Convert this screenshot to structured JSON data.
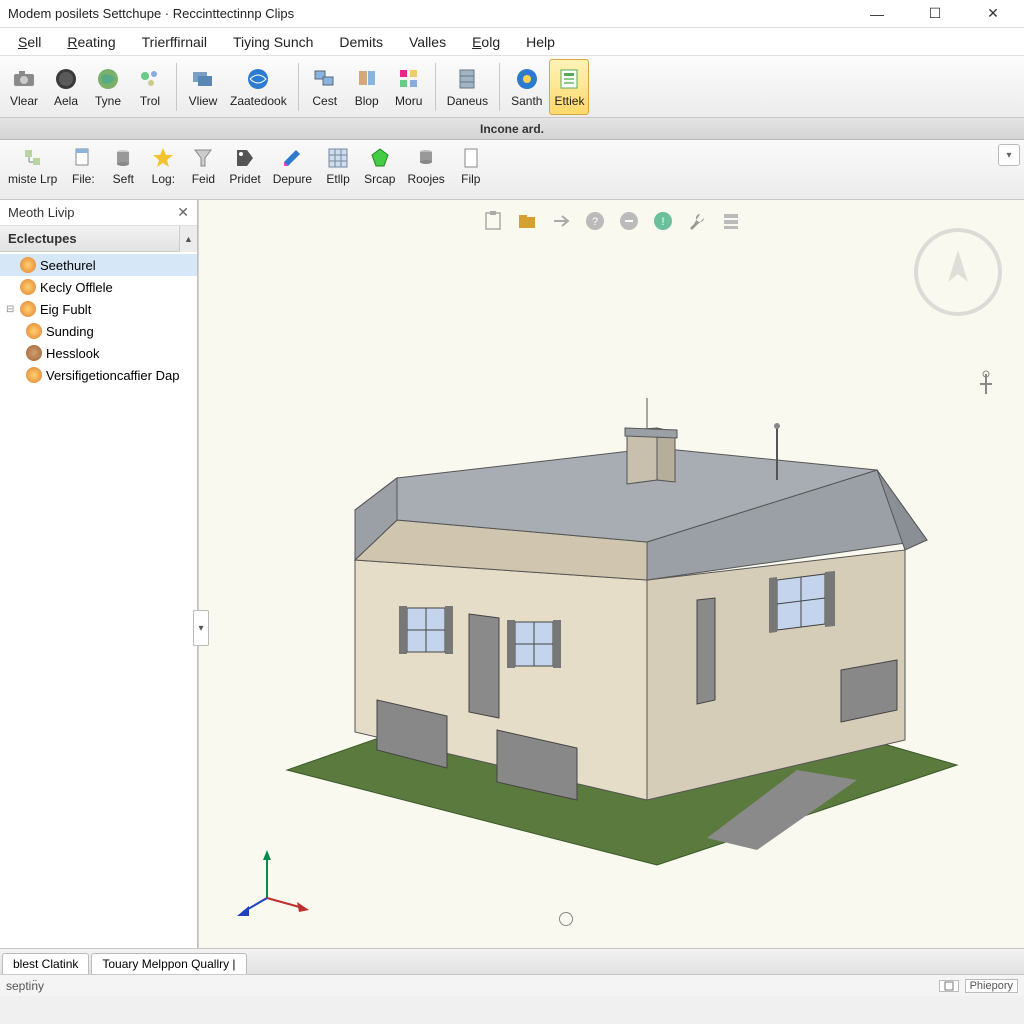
{
  "window": {
    "title": "Modem posilets Settchupe · Reccinttectinnp Clips"
  },
  "menu": {
    "items": [
      {
        "label": "Sell",
        "ul": "S"
      },
      {
        "label": "Reating",
        "ul": "R"
      },
      {
        "label": "Trierffirnail",
        "ul": ""
      },
      {
        "label": "Tiying Sunch",
        "ul": ""
      },
      {
        "label": "Demits",
        "ul": ""
      },
      {
        "label": "Valles",
        "ul": ""
      },
      {
        "label": "Eolg",
        "ul": "E"
      },
      {
        "label": "Help",
        "ul": ""
      }
    ]
  },
  "toolbar1": {
    "groups": [
      [
        {
          "label": "Vlear",
          "icon": "camera",
          "color": "#6b6b6b"
        },
        {
          "label": "Aela",
          "icon": "globe-dark",
          "color": "#434343"
        },
        {
          "label": "Tyne",
          "icon": "earth",
          "color": "#8a6"
        },
        {
          "label": "Trol",
          "icon": "sparkle",
          "color": "#6aa"
        }
      ],
      [
        {
          "label": "Vliew",
          "icon": "folders",
          "color": "#6a8"
        },
        {
          "label": "Zaatedook",
          "icon": "globe-blue",
          "color": "#2b7bd1"
        }
      ],
      [
        {
          "label": "Cest",
          "icon": "windows",
          "color": "#6a9bd4"
        },
        {
          "label": "Blop",
          "icon": "stack",
          "color": "#c98"
        },
        {
          "label": "Moru",
          "icon": "grid",
          "color": "#d88"
        }
      ],
      [
        {
          "label": "Daneus",
          "icon": "cabinet",
          "color": "#8aa"
        }
      ],
      [
        {
          "label": "Santh",
          "icon": "disc",
          "color": "#2b7bd1"
        },
        {
          "label": "Ettiek",
          "icon": "sheet",
          "color": "#5a5",
          "selected": true
        }
      ]
    ]
  },
  "doc_tab": "Incone ard.",
  "toolbar2": {
    "items": [
      {
        "label": "miste Lrp",
        "icon": "tree"
      },
      {
        "label": "File:",
        "icon": "doc"
      },
      {
        "label": "Seft",
        "icon": "can"
      },
      {
        "label": "Log:",
        "icon": "star"
      },
      {
        "label": "Feid",
        "icon": "funnel"
      },
      {
        "label": "Pridet",
        "icon": "tag"
      },
      {
        "label": "Depure",
        "icon": "pencil"
      },
      {
        "label": "Etllp",
        "icon": "grid2"
      },
      {
        "label": "Srcap",
        "icon": "gem"
      },
      {
        "label": "Roojes",
        "icon": "cylinder"
      },
      {
        "label": "Filp",
        "icon": "page"
      }
    ]
  },
  "panel": {
    "title": "Meoth Livip",
    "section": "Eclectupes",
    "tree": [
      {
        "label": "Seethurel",
        "level": 0,
        "sel": true,
        "ico": "orange"
      },
      {
        "label": "Kecly Offlele",
        "level": 0,
        "ico": "orange"
      },
      {
        "label": "Eig Fublt",
        "level": 0,
        "ico": "orange",
        "tog": "-"
      },
      {
        "label": "Sunding",
        "level": 1,
        "ico": "orange"
      },
      {
        "label": "Hesslook",
        "level": 1,
        "ico": "brown"
      },
      {
        "label": "Versifigetioncaffier Dap",
        "level": 1,
        "ico": "orange"
      }
    ]
  },
  "viewport_icons": [
    "clipboard",
    "folder",
    "arrow",
    "num1",
    "num2",
    "num3",
    "wrench",
    "stack2"
  ],
  "bottom_tabs": [
    "blest Clatink",
    "Touary Melppon Quallry |"
  ],
  "status": {
    "left": "septin̈y",
    "right_label": "Phiepory"
  },
  "colors": {
    "selected_bg": "#ffe08a"
  }
}
